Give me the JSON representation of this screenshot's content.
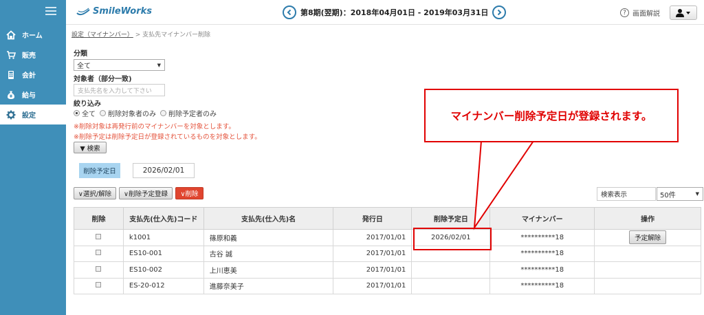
{
  "logo": "SmileWorks",
  "header": {
    "period": "第8期(翌期)：2018年04月01日 - 2019年03月31日",
    "help_label": "画面解説"
  },
  "sidebar": {
    "items": [
      {
        "label": "ホーム",
        "icon": "home-icon"
      },
      {
        "label": "販売",
        "icon": "cart-icon"
      },
      {
        "label": "会計",
        "icon": "calculator-icon"
      },
      {
        "label": "給与",
        "icon": "money-bag-icon"
      },
      {
        "label": "設定",
        "icon": "gear-icon",
        "active": true
      }
    ]
  },
  "breadcrumb": {
    "parent": "設定（マイナンバー）",
    "separator": ">",
    "current": "支払先マイナンバー削除"
  },
  "filters": {
    "category_label": "分類",
    "category_value": "全て",
    "target_label": "対象者（部分一致)",
    "target_placeholder": "支払先名を入力して下さい",
    "narrow_label": "絞り込み",
    "radios": [
      "全て",
      "削除対象者のみ",
      "削除予定者のみ"
    ],
    "note1": "※削除対象は再発行前のマイナンバーを対象とします。",
    "note2": "※削除予定は削除予定日が登録されているものを対象とします。",
    "search_button": "▼ 検索"
  },
  "schedule": {
    "tag": "削除予定日",
    "date": "2026/02/01"
  },
  "actions": {
    "toggle": "∨選択/解除",
    "register": "∨削除予定登録",
    "delete": "∨削除",
    "display_label": "検索表示",
    "display_value": "50件"
  },
  "table": {
    "headers": [
      "削除",
      "支払先(仕入先)コード",
      "支払先(仕入先)名",
      "発行日",
      "削除予定日",
      "マイナンバー",
      "操作"
    ],
    "rows": [
      {
        "code": "k1001",
        "name": "篠原和義",
        "issued": "2017/01/01",
        "scheduled": "2026/02/01",
        "mynumber": "**********18",
        "op": "予定解除"
      },
      {
        "code": "ES10-001",
        "name": "古谷 誠",
        "issued": "2017/01/01",
        "scheduled": "",
        "mynumber": "**********18",
        "op": ""
      },
      {
        "code": "ES10-002",
        "name": "上川恵美",
        "issued": "2017/01/01",
        "scheduled": "",
        "mynumber": "**********18",
        "op": ""
      },
      {
        "code": "ES-20-012",
        "name": "進藤奈美子",
        "issued": "2017/01/01",
        "scheduled": "",
        "mynumber": "**********18",
        "op": ""
      }
    ]
  },
  "callout": "マイナンバー削除予定日が登録されます。",
  "colors": {
    "sidebar": "#3f8fb9",
    "accent": "#2c7bab",
    "annotation": "#e10000",
    "delete_button": "#e0452f"
  }
}
